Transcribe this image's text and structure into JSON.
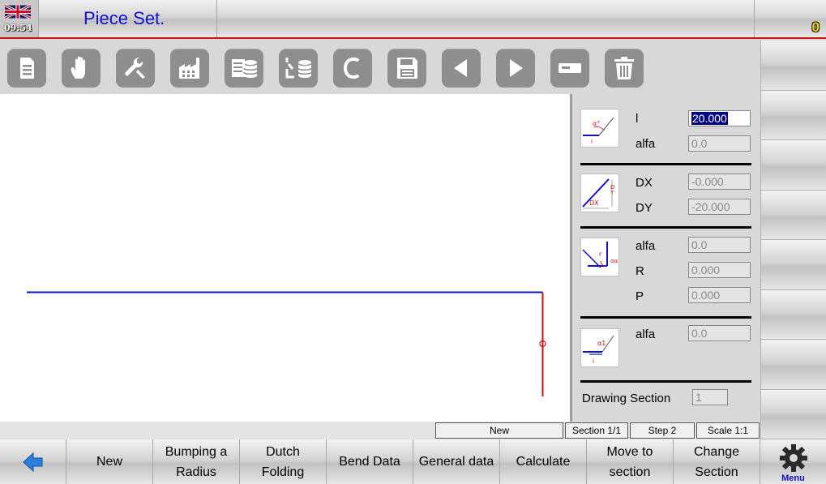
{
  "header": {
    "clock": "09:54",
    "title": "Piece Set.",
    "counter": "0",
    "flag_icon": "uk-flag-icon"
  },
  "toolbar": {
    "icons": [
      "document-icon",
      "hand-icon",
      "wrench-icon",
      "factory-icon",
      "database-list-icon",
      "database-bend-icon",
      "c-letter-icon",
      "save-icon",
      "arrow-left-icon",
      "arrow-right-icon",
      "minus-rect-icon",
      "trash-icon"
    ]
  },
  "panel": {
    "length": {
      "label": "l",
      "value": "20.000"
    },
    "alfa1": {
      "label": "alfa",
      "value": "0.0"
    },
    "dx": {
      "label": "DX",
      "value": "-0.000"
    },
    "dy": {
      "label": "DY",
      "value": "-20.000"
    },
    "alfa2": {
      "label": "alfa",
      "value": "0.0"
    },
    "r": {
      "label": "R",
      "value": "0.000"
    },
    "p": {
      "label": "P",
      "value": "0.000"
    },
    "alfa3": {
      "label": "alfa",
      "value": "0.0"
    },
    "drawing_section": {
      "label": "Drawing Section",
      "value": "1"
    }
  },
  "status": {
    "mode": "New",
    "section": "Section 1/1",
    "step": "Step 2",
    "scale": "Scale 1:1"
  },
  "bottom": {
    "new": "New",
    "bumping": "Bumping a\nRadius",
    "dutch": "Dutch\nFolding",
    "bend_data": "Bend Data",
    "general": "General data",
    "calculate": "Calculate",
    "move": "Move to\nsection",
    "change": "Change\nSection",
    "menu": "Menu"
  },
  "colors": {
    "title": "#1010c8",
    "line_blue": "#1010c8",
    "line_red": "#d01010",
    "counter": "#e8d200"
  }
}
